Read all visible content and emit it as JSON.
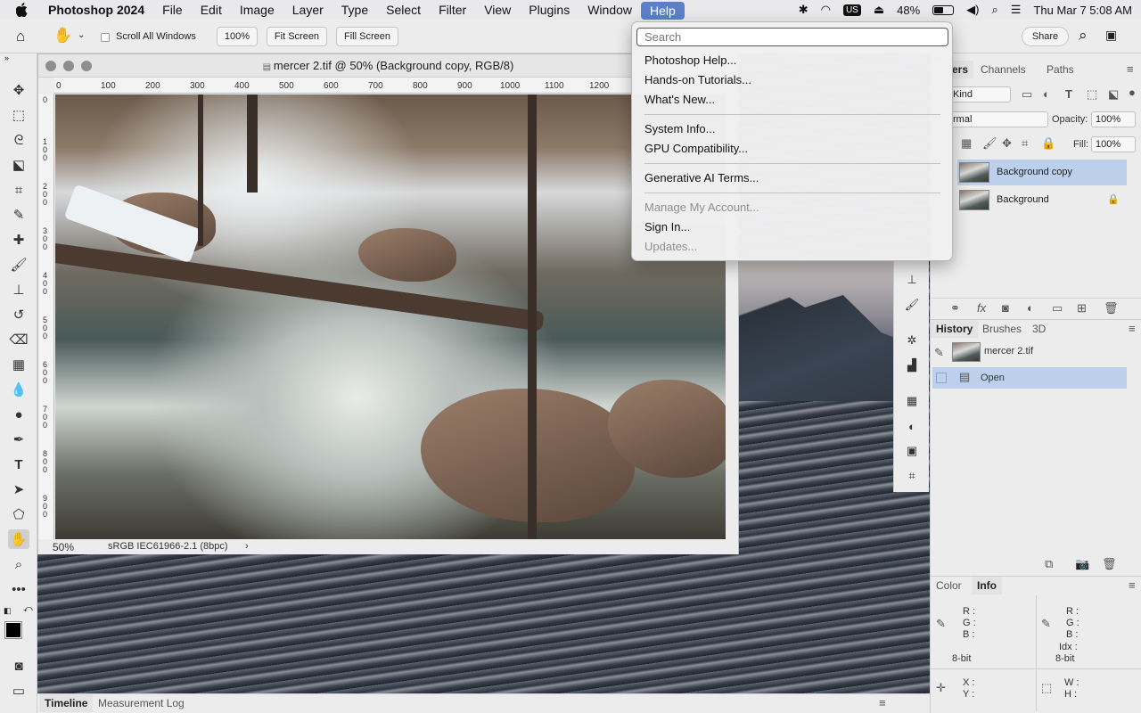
{
  "menubar": {
    "app_name": "Photoshop 2024",
    "menus": [
      "File",
      "Edit",
      "Image",
      "Layer",
      "Type",
      "Select",
      "Filter",
      "View",
      "Plugins",
      "Window",
      "Help"
    ],
    "input_source": "US",
    "battery": "48%",
    "clock": "Thu Mar 7  5:08 AM"
  },
  "options_bar": {
    "scroll_all_windows": "Scroll All Windows",
    "zoom_value": "100%",
    "fit_screen": "Fit Screen",
    "fill_screen": "Fill Screen",
    "share": "Share"
  },
  "document": {
    "title": "mercer 2.tif @ 50% (Background copy, RGB/8)",
    "ruler_h": [
      "0",
      "100",
      "200",
      "300",
      "400",
      "500",
      "600",
      "700",
      "800",
      "900",
      "1000",
      "1100",
      "1200"
    ],
    "ruler_v": [
      "0",
      "100",
      "200",
      "300",
      "400",
      "500",
      "600",
      "700",
      "800",
      "900"
    ],
    "zoom": "50%",
    "profile": "sRGB IEC61966-2.1 (8bpc)"
  },
  "help_menu": {
    "search_placeholder": "Search",
    "items": [
      {
        "label": "Photoshop Help...",
        "enabled": true
      },
      {
        "label": "Hands-on Tutorials...",
        "enabled": true
      },
      {
        "label": "What's New...",
        "enabled": true
      },
      {
        "label": "System Info...",
        "enabled": true
      },
      {
        "label": "GPU Compatibility...",
        "enabled": true
      },
      {
        "label": "Generative AI Terms...",
        "enabled": true
      },
      {
        "label": "Manage My Account...",
        "enabled": false
      },
      {
        "label": "Sign In...",
        "enabled": true
      },
      {
        "label": "Updates...",
        "enabled": false
      }
    ]
  },
  "layers_panel": {
    "tabs": [
      "ers",
      "Channels",
      "Paths"
    ],
    "kind": "Kind",
    "blend_mode": "rmal",
    "opacity_label": "Opacity:",
    "opacity_value": "100%",
    "fill_label": "Fill:",
    "fill_value": "100%",
    "layers": [
      {
        "name": "Background copy",
        "selected": true,
        "locked": false
      },
      {
        "name": "Background",
        "selected": false,
        "locked": true
      }
    ]
  },
  "history_panel": {
    "tabs": [
      "History",
      "Brushes",
      "3D"
    ],
    "snapshot": "mercer 2.tif",
    "states": [
      "Open"
    ]
  },
  "info_panel": {
    "tabs": [
      "Color",
      "Info"
    ],
    "rgb_labels": [
      "R :",
      "G :",
      "B :"
    ],
    "rgb2_labels": [
      "R :",
      "G :",
      "B :",
      "Idx :"
    ],
    "bit_depth": "8-bit",
    "bit_depth2": "8-bit",
    "xy_labels": [
      "X :",
      "Y :"
    ],
    "wh_labels": [
      "W :",
      "H :"
    ]
  },
  "bottom_tabs": [
    "Timeline",
    "Measurement Log"
  ],
  "colors": {
    "menu_highlight": "#5a80c9",
    "selection": "#bcd0ec"
  }
}
